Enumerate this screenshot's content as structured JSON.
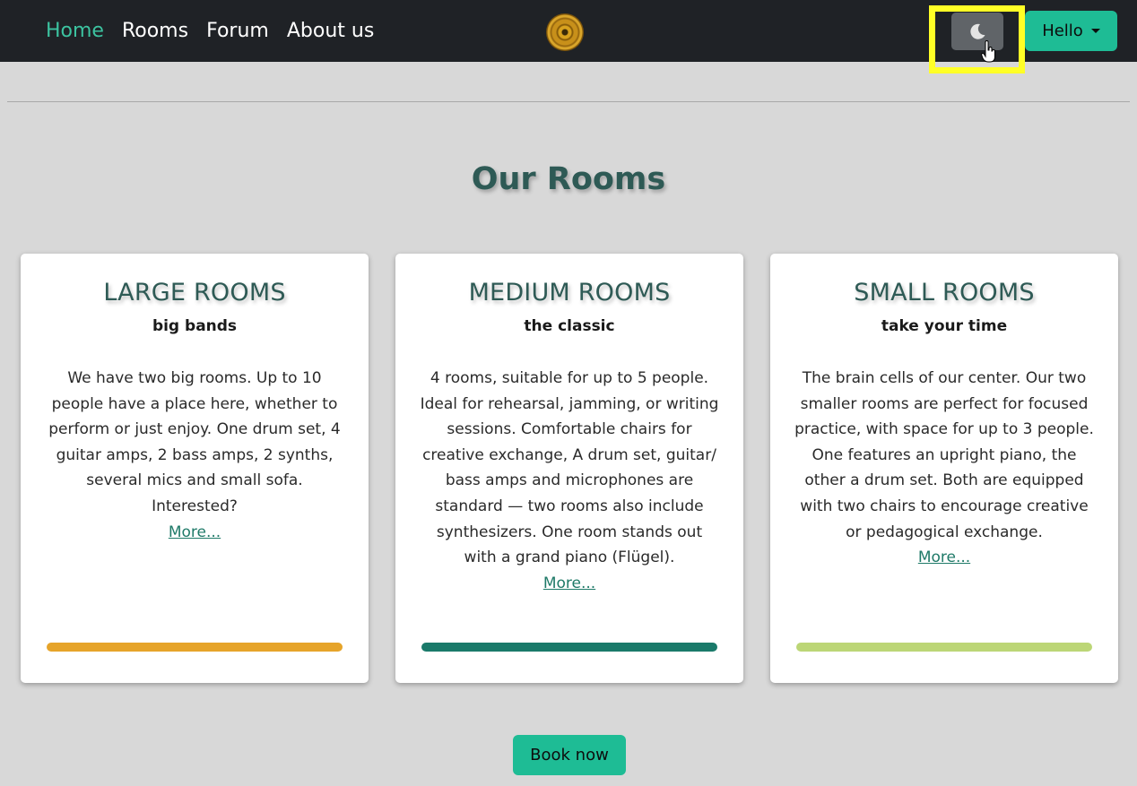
{
  "nav": {
    "links": [
      "Home",
      "Rooms",
      "Forum",
      "About us"
    ],
    "active_color": "#3cc3a0",
    "logo_icon": "vinyl-record-icon",
    "theme_toggle_icon": "moon-icon",
    "user_menu_label": "Hello"
  },
  "main": {
    "title": "Our Rooms",
    "cards": [
      {
        "title": "LARGE ROOMS",
        "subtitle": "big bands",
        "description": "We have two big rooms. Up to 10 people have a place here, whether to perform or just enjoy. One drum set, 4 guitar amps, 2 bass amps, 2 synths, several mics and small sofa. Interested?",
        "more_label": "More...",
        "bar_color": "#e6a42a"
      },
      {
        "title": "MEDIUM ROOMS",
        "subtitle": "the classic",
        "description": "4 rooms, suitable for up to 5 people. Ideal for rehearsal, jamming, or writing sessions. Comfortable chairs for creative exchange, A drum set, guitar/ bass amps and microphones are standard — two rooms also include synthesizers. One room stands out with a grand piano (Flügel).",
        "more_label": "More...",
        "bar_color": "#1a7a6a"
      },
      {
        "title": "SMALL ROOMS",
        "subtitle": "take your time",
        "description": "The brain cells of our center. Our two smaller rooms are perfect for focused practice, with space for up to 3 people. One features an upright piano, the other a drum set. Both are equipped with two chairs to encourage creative or pedagogical exchange.",
        "more_label": "More...",
        "bar_color": "#bcd676"
      }
    ],
    "book_label": "Book now"
  },
  "colors": {
    "brand": "#1ebc95",
    "heading": "#2e5a55",
    "highlight": "#ffff26"
  }
}
